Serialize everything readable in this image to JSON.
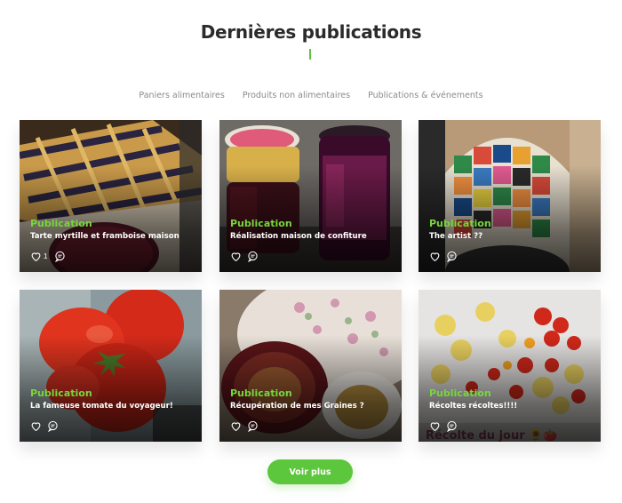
{
  "section": {
    "title": "Dernières publications",
    "accent_color": "#5cc63c"
  },
  "filters": [
    "Paniers alimentaires",
    "Produits non alimentaires",
    "Publications & événements"
  ],
  "posts": [
    {
      "category": "Publication",
      "title": "Tarte myrtille et framboise maison",
      "likes": "1"
    },
    {
      "category": "Publication",
      "title": "Réalisation maison de confiture",
      "likes": ""
    },
    {
      "category": "Publication",
      "title": "The artist ??",
      "likes": ""
    },
    {
      "category": "Publication",
      "title": "La fameuse tomate du voyageur!",
      "likes": ""
    },
    {
      "category": "Publication",
      "title": "Récupération de mes Graines ?",
      "likes": ""
    },
    {
      "category": "Publication",
      "title": "Récoltes récoltes!!!!",
      "likes": ""
    }
  ],
  "more_button": "Voir plus",
  "colors": {
    "category_green": "#76d63b",
    "button_green": "#5cc63c"
  }
}
